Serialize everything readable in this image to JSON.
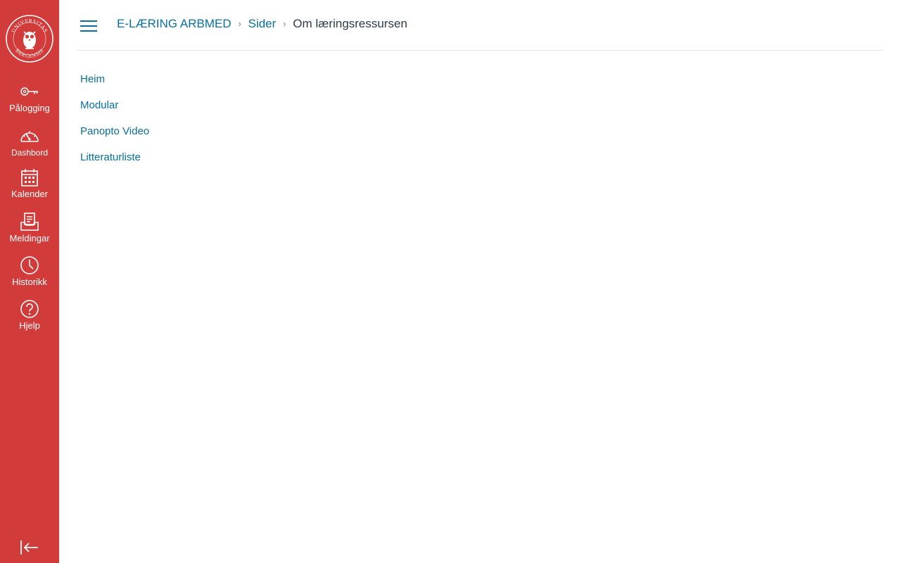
{
  "global_nav": {
    "logo_text": "UNIVERSITAS BERGENSIS",
    "items": [
      {
        "label": "Pålogging",
        "icon": "key-icon"
      },
      {
        "label": "Dashbord",
        "icon": "dashboard-icon"
      },
      {
        "label": "Kalender",
        "icon": "calendar-icon"
      },
      {
        "label": "Meldingar",
        "icon": "inbox-icon"
      },
      {
        "label": "Historikk",
        "icon": "clock-icon"
      },
      {
        "label": "Hjelp",
        "icon": "help-icon"
      }
    ],
    "collapse_icon": "collapse-nav-icon"
  },
  "header": {
    "menu_icon": "hamburger-icon",
    "breadcrumb": {
      "course": "E-LÆRING ARBMED",
      "section": "Sider",
      "current": "Om læringsressursen",
      "separator": "›"
    }
  },
  "course_nav": {
    "items": [
      {
        "label": "Heim"
      },
      {
        "label": "Modular"
      },
      {
        "label": "Panopto Video"
      },
      {
        "label": "Litteraturliste"
      }
    ]
  },
  "colors": {
    "nav_background": "#d13c3a",
    "link": "#0770a3",
    "text": "#2d3b45",
    "divider": "#e4e6e8"
  }
}
